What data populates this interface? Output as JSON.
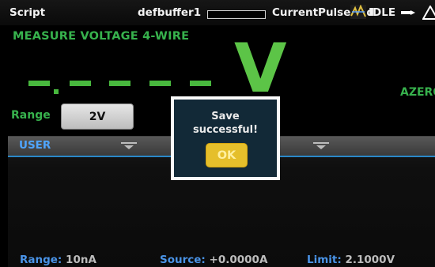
{
  "statusbar": {
    "mode": "Script",
    "buffer": "defbuffer1",
    "script_name": "CurrentPulseAnd",
    "state": "IDLE"
  },
  "measure": {
    "title": "MEASURE VOLTAGE 4-WIRE",
    "unit": "V",
    "azero": "AZERO",
    "range_label": "Range",
    "range_value": "2V"
  },
  "swipe": {
    "title": "USER",
    "range_label": "Range:",
    "range_value": "10nA",
    "source_label": "Source:",
    "source_value": "+0.0000A",
    "limit_label": "Limit:",
    "limit_value": "2.1000V"
  },
  "dialog": {
    "message": "Save\nsuccessful!",
    "ok_label": "OK"
  },
  "colors": {
    "measure_green": "#37b24d",
    "swipe_blue": "#4a94e8",
    "dialog_bg": "#122937",
    "ok_yellow": "#e5bf2b"
  }
}
